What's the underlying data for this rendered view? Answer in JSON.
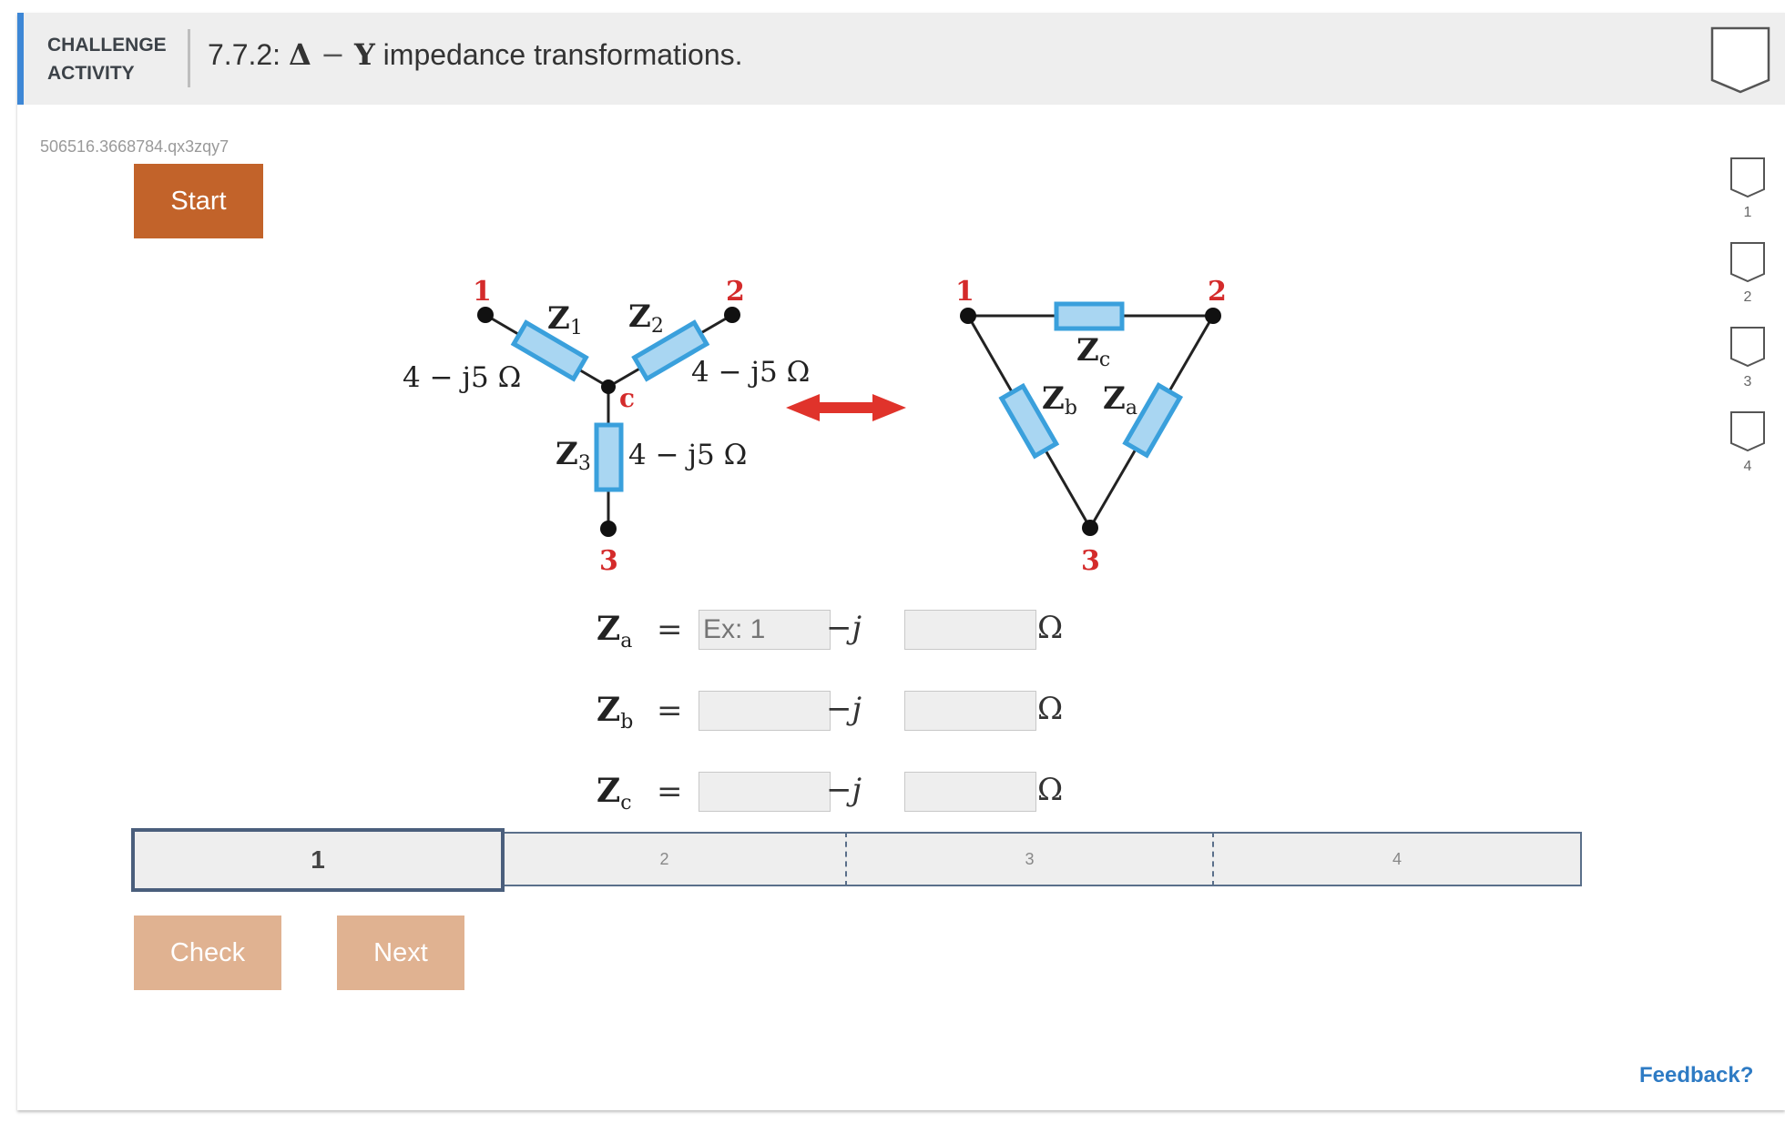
{
  "header": {
    "activity_label_line1": "CHALLENGE",
    "activity_label_line2": "ACTIVITY",
    "title_prefix": "7.7.2: ",
    "title_delta": "Δ",
    "title_dash": " − ",
    "title_y": "Y",
    "title_suffix": " impedance transformations."
  },
  "activity_code": "506516.3668784.qx3zqy7",
  "start_label": "Start",
  "side_levels": [
    "1",
    "2",
    "3",
    "4"
  ],
  "diagram": {
    "wye": {
      "node_1": "1",
      "node_2": "2",
      "node_3": "3",
      "center": "c",
      "z1": "Z",
      "z1_sub": "1",
      "z2": "Z",
      "z2_sub": "2",
      "z3": "Z",
      "z3_sub": "3",
      "imp1": "4 − j5 Ω",
      "imp2": "4 − j5 Ω",
      "imp3": "4 − j5 Ω"
    },
    "delta": {
      "node_1": "1",
      "node_2": "2",
      "node_3": "3",
      "za": "Z",
      "za_sub": "a",
      "zb": "Z",
      "zb_sub": "b",
      "zc": "Z",
      "zc_sub": "c"
    },
    "colors": {
      "resistor_fill": "#a9d6f2",
      "resistor_stroke": "#3aa0dc",
      "node_label": "#d42b2b",
      "arrow": "#e0332b"
    }
  },
  "equations": [
    {
      "var": "Z",
      "sub": "a",
      "eq": "=",
      "real_placeholder": "Ex: 1",
      "imag_placeholder": "",
      "j": "−j",
      "unit": "Ω"
    },
    {
      "var": "Z",
      "sub": "b",
      "eq": "=",
      "real_placeholder": "",
      "imag_placeholder": "",
      "j": "−j",
      "unit": "Ω"
    },
    {
      "var": "Z",
      "sub": "c",
      "eq": "=",
      "real_placeholder": "",
      "imag_placeholder": "",
      "j": "−j",
      "unit": "Ω"
    }
  ],
  "progress": {
    "segments": [
      "1",
      "2",
      "3",
      "4"
    ],
    "active": 1
  },
  "buttons": {
    "check": "Check",
    "next": "Next"
  },
  "feedback": "Feedback?"
}
